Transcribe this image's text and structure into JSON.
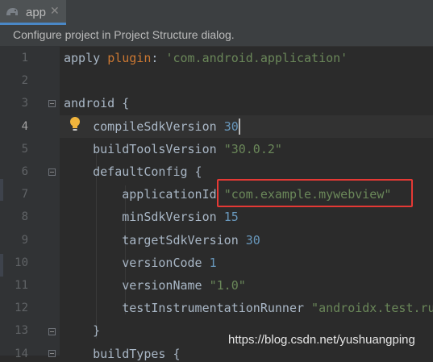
{
  "tab": {
    "label": "app",
    "close": "✕",
    "icon": "gradle-elephant-icon"
  },
  "banner": {
    "text": "Configure project in Project Structure dialog."
  },
  "editor": {
    "line_numbers": [
      "1",
      "2",
      "3",
      "4",
      "5",
      "6",
      "7",
      "8",
      "9",
      "10",
      "11",
      "12",
      "13",
      "14"
    ],
    "current_line": "4",
    "lines": [
      [
        {
          "t": "apply ",
          "c": "plain"
        },
        {
          "t": "plugin",
          "c": "kw"
        },
        {
          "t": ": ",
          "c": "plain"
        },
        {
          "t": "'com.android.application'",
          "c": "str"
        }
      ],
      [],
      [
        {
          "t": "android {",
          "c": "plain"
        }
      ],
      [
        {
          "t": "    compileSdkVersion ",
          "c": "plain"
        },
        {
          "t": "30",
          "c": "num"
        }
      ],
      [
        {
          "t": "    buildToolsVersion ",
          "c": "plain"
        },
        {
          "t": "\"30.0.2\"",
          "c": "str"
        }
      ],
      [
        {
          "t": "    defaultConfig {",
          "c": "plain"
        }
      ],
      [
        {
          "t": "        applicationId ",
          "c": "plain"
        },
        {
          "t": "\"com.example.mywebview\"",
          "c": "str"
        }
      ],
      [
        {
          "t": "        minSdkVersion ",
          "c": "plain"
        },
        {
          "t": "15",
          "c": "num"
        }
      ],
      [
        {
          "t": "        targetSdkVersion ",
          "c": "plain"
        },
        {
          "t": "30",
          "c": "num"
        }
      ],
      [
        {
          "t": "        versionCode ",
          "c": "plain"
        },
        {
          "t": "1",
          "c": "num"
        }
      ],
      [
        {
          "t": "        versionName ",
          "c": "plain"
        },
        {
          "t": "\"1.0\"",
          "c": "str"
        }
      ],
      [
        {
          "t": "        testInstrumentationRunner ",
          "c": "plain"
        },
        {
          "t": "\"androidx.test.ru",
          "c": "str"
        }
      ],
      [
        {
          "t": "    }",
          "c": "plain"
        }
      ],
      [
        {
          "t": "    buildTypes {",
          "c": "plain"
        }
      ]
    ]
  },
  "watermark": "https://blog.csdn.net/yushuangping",
  "colors": {
    "background": "#2b2b2b",
    "keyword": "#cc7832",
    "string": "#6a8759",
    "number": "#6897bb",
    "highlight": "#e53935"
  }
}
